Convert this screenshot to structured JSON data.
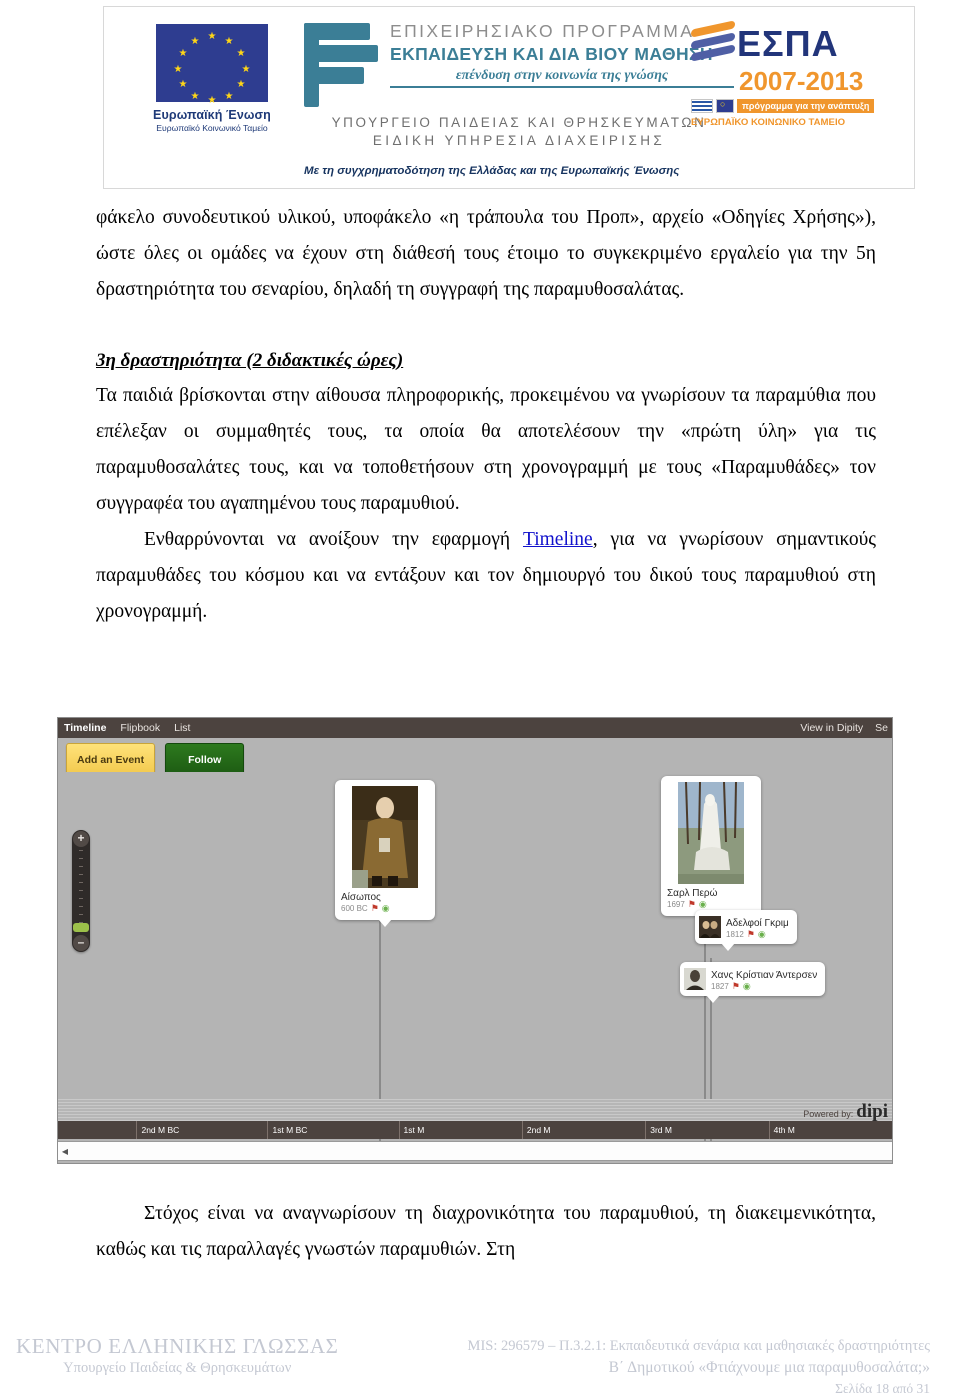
{
  "header": {
    "eu": {
      "flag_alt": "eu-flag",
      "title": "Ευρωπαϊκή Ένωση",
      "subtitle": "Ευρωπαϊκό Κοινωνικό Ταμείο"
    },
    "programme": {
      "line1": "ΕΠΙΧΕΙΡΗΣΙΑΚΟ ΠΡΟΓΡΑΜΜΑ",
      "line2": "ΕΚΠΑΙΔΕΥΣΗ ΚΑΙ ΔΙΑ ΒΙΟΥ ΜΑΘΗΣΗ",
      "line3": "επένδυση στην κοινωνία της γνώσης",
      "line4": "ΥΠΟΥΡΓΕΙΟ ΠΑΙΔΕΙΑΣ ΚΑΙ ΘΡΗΣΚΕΥΜΑΤΩΝ",
      "line5": "ΕΙΔΙΚΗ ΥΠΗΡΕΣΙΑ ΔΙΑΧΕΙΡΙΣΗΣ"
    },
    "cofunding": "Με τη συγχρηματοδότηση της Ελλάδας και της Ευρωπαϊκής Ένωσης",
    "espa": {
      "word": "ΕΣΠΑ",
      "years": "2007-2013",
      "tag": "πρόγραμμα για την ανάπτυξη",
      "fund": "ΕΥΡΩΠΑΪΚΟ ΚΟΙΝΩΝΙΚΟ ΤΑΜΕΙΟ"
    }
  },
  "body": {
    "paragraph1": "φάκελο συνοδευτικού υλικού, υποφάκελο «η τράπουλα του Προπ», αρχείο «Οδηγίες Χρήσης»), ώστε όλες οι ομάδες να έχουν στη διάθεσή τους έτοιμο το συγκεκριμένο εργαλείο για την 5η δραστηριότητα του σεναρίου, δηλαδή τη συγγραφή της παραμυθοσαλάτας.",
    "subheading": "3η δραστηριότητα (2 διδακτικές ώρες)",
    "paragraph2": "Τα παιδιά βρίσκονται στην αίθουσα πληροφορικής, προκειμένου να γνωρίσουν τα παραμύθια που επέλεξαν οι συμμαθητές τους, τα οποία θα αποτελέσουν την «πρώτη ύλη» για τις παραμυθοσαλάτες τους, και να τοποθετήσουν στη χρονογραμμή με τους «Παραμυθάδες» τον συγγραφέα του αγαπημένου τους παραμυθιού.",
    "paragraph3_before_link": "Ενθαρρύνονται να ανοίξουν την εφαρμογή ",
    "paragraph3_link": "Timeline",
    "paragraph3_after_link": ", για να γνωρίσουν σημαντικούς παραμυθάδες του κόσμου και να εντάξουν και τον δημιουργό του δικού τους παραμυθιού στη χρονογραμμή.",
    "paragraph4": "Στόχος είναι να αναγνωρίσουν τη διαχρονικότητα του παραμυθιού, τη διακειμενικότητα, καθώς και τις παραλλαγές γνωστών παραμυθιών. Στη"
  },
  "screenshot": {
    "tabs": [
      {
        "label": "Timeline",
        "active": true
      },
      {
        "label": "Flipbook",
        "active": false
      },
      {
        "label": "List",
        "active": false
      }
    ],
    "top_right_links": [
      "View in Dipity",
      "Se"
    ],
    "buttons": {
      "add_event": "Add an Event",
      "follow": "Follow"
    },
    "zoom_control": {
      "plus": "+",
      "minus": "–"
    },
    "events": [
      {
        "title": "Αίσωπος",
        "date": "600 BC",
        "pin_count": "0",
        "comment_count": "0",
        "type": "large"
      },
      {
        "title": "Σαρλ Περώ",
        "date": "1697",
        "pin_count": "0",
        "comment_count": "0",
        "type": "large"
      },
      {
        "title": "Αδελφοί Γκριμ",
        "date": "1812",
        "pin_count": "0",
        "comment_count": "0",
        "type": "small"
      },
      {
        "title": "Χανς Κρίστιαν Άντερσεν",
        "date": "1827",
        "pin_count": "0",
        "comment_count": "0",
        "type": "small"
      }
    ],
    "powered_by_label": "Powered by:",
    "powered_by_brand": "dipi",
    "axis_ticks": [
      "2nd M BC",
      "1st M BC",
      "1st M",
      "2nd M",
      "3rd M",
      "4th M"
    ],
    "scroll_arrow": "◀"
  },
  "footer": {
    "left_line1": "ΚΕΝΤΡΟ ΕΛΛΗΝΙΚΗΣ ΓΛΩΣΣΑΣ",
    "left_line2": "Υπουργείο Παιδείας & Θρησκευμάτων",
    "right_line1": "MIS: 296579 – Π.3.2.1: Εκπαιδευτικά σενάρια και μαθησιακές δραστηριότητες",
    "right_line2": "Β΄ Δημοτικού «Φτιάχνουμε μια παραμυθοσαλάτα;»",
    "right_line3": "Σελίδα 18 από 31"
  },
  "colors": {
    "link": "#1111cc",
    "teal": "#3b7e96",
    "eu_blue": "#2e3d90",
    "espa_blue": "#22357a",
    "espa_orange": "#f0962d",
    "footer_grey": "#c4c8d2"
  }
}
